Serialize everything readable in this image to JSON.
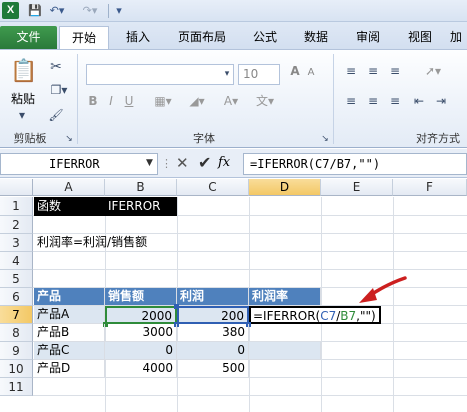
{
  "window": {
    "app_icon": "excel-icon",
    "quick_access": [
      "save-icon",
      "undo-icon",
      "redo-icon",
      "customize-icon"
    ]
  },
  "ribbon": {
    "tabs": [
      "文件",
      "开始",
      "插入",
      "页面布局",
      "公式",
      "数据",
      "审阅",
      "视图",
      "加"
    ],
    "active_tab": "开始",
    "paste_label": "粘贴",
    "groups": {
      "clipboard": "剪贴板",
      "font": "字体",
      "alignment": "对齐方式"
    },
    "font_size": "10"
  },
  "formula_bar": {
    "name_box": "IFERROR",
    "fx": "fx",
    "formula": "=IFERROR(C7/B7,\"\")"
  },
  "sheet": {
    "columns": [
      "A",
      "B",
      "C",
      "D",
      "E",
      "F"
    ],
    "rows": [
      "1",
      "2",
      "3",
      "4",
      "5",
      "6",
      "7",
      "8",
      "9",
      "10",
      "11"
    ],
    "cells": {
      "A1": "函数",
      "B1": "IFERROR",
      "A3": "利润率=利润/销售额",
      "A6": "产品",
      "B6": "销售额",
      "C6": "利润",
      "D6": "利润率",
      "A7": "产品A",
      "B7": "2000",
      "C7": "200",
      "D7_parts": [
        "=IFERROR(",
        "C7",
        "/",
        "B7",
        ",\"\")"
      ],
      "A8": "产品B",
      "B8": "3000",
      "C8": "380",
      "A9": "产品C",
      "B9": "0",
      "C9": "0",
      "A10": "产品D",
      "B10": "4000",
      "C10": "500"
    }
  },
  "colors": {
    "header_blue": "#4f81bd",
    "band_blue": "#dce6f1",
    "ref_blue": "#2f5fb3",
    "ref_green": "#2e8b3a",
    "arrow_red": "#cc1f1f",
    "file_tab_green": "#2a7a3a"
  }
}
